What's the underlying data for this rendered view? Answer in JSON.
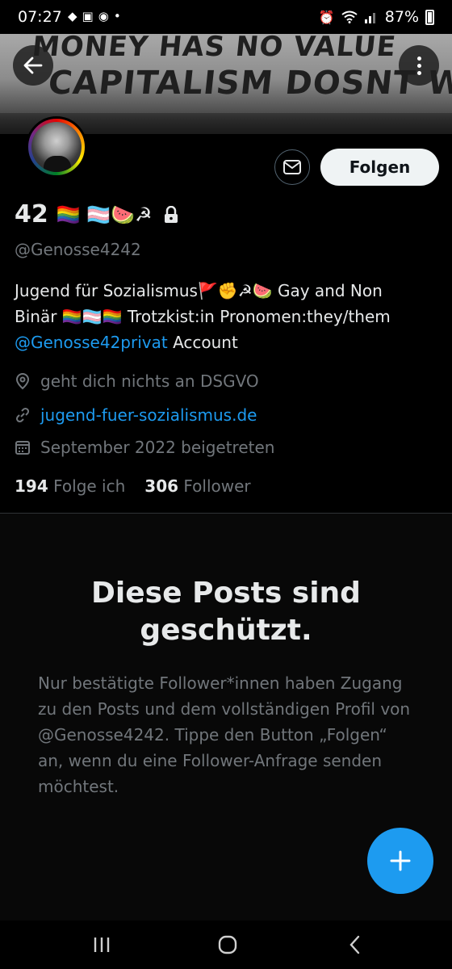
{
  "status_bar": {
    "time": "07:27",
    "battery": "87%"
  },
  "banner": {
    "line1": "MONEY HAS NO VALUE",
    "line2": "CAPITALISM DOSNT WORK!"
  },
  "profile": {
    "display_name": "42",
    "name_emojis": "🏳️‍🌈 🏳️‍⚧️🍉☭",
    "handle": "@Genosse4242",
    "follow_label": "Folgen",
    "bio_line1": "Jugend für Sozialismus🚩✊☭🍉   Gay and Non",
    "bio_line2": "Binär 🏳️‍🌈🏳️‍⚧️🏳️‍🌈   Trotzkist:in   Pronomen:they/them",
    "bio_mention": "@Genosse42privat",
    "bio_mention_suffix": " Account",
    "location": "geht dich nichts an DSGVO",
    "website": "jugend-fuer-sozialismus.de",
    "joined": "September 2022 beigetreten",
    "following_count": "194",
    "following_label": "Folge ich",
    "followers_count": "306",
    "followers_label": "Follower"
  },
  "protected": {
    "title": "Diese Posts sind geschützt.",
    "text": "Nur bestätigte Follower*innen haben Zugang zu den Posts und dem vollständigen Profil von @Genosse4242. Tippe den Button „Folgen“ an, wenn du eine Follower-Anfrage senden möchtest."
  },
  "colors": {
    "accent": "#1d9bf0",
    "muted": "#71767b",
    "text": "#e7e9ea",
    "background": "#000000"
  },
  "icons": {
    "back": "arrow-left-icon",
    "more": "more-vertical-icon",
    "mail": "mail-icon",
    "lock": "lock-icon",
    "location": "location-pin-icon",
    "link": "link-icon",
    "calendar": "calendar-icon",
    "compose": "plus-icon"
  }
}
